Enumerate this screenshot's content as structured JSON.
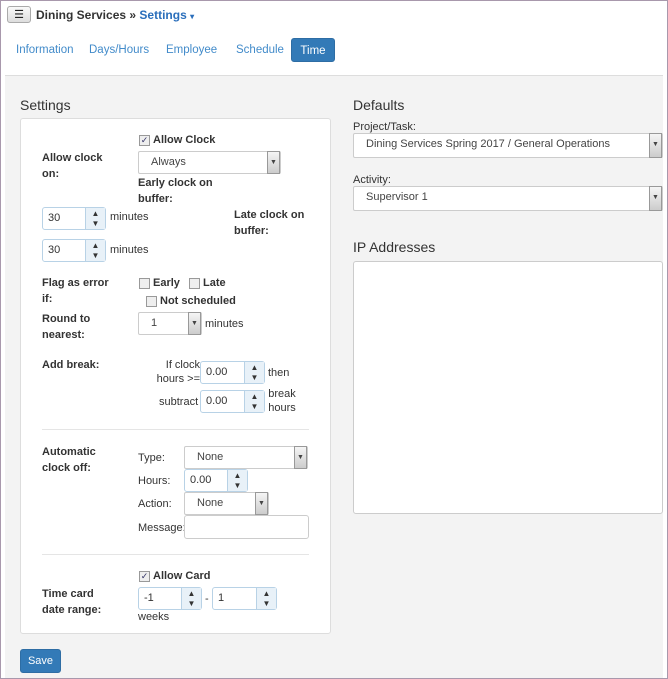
{
  "header": {
    "menu_icon": "hamburger-icon",
    "org": "Dining Services",
    "separator": "»",
    "page": "Settings",
    "caret": "▾"
  },
  "tabs": [
    {
      "label": "Information"
    },
    {
      "label": "Days/Hours"
    },
    {
      "label": "Employee"
    },
    {
      "label": "Schedule"
    },
    {
      "label": "Time",
      "active": true
    }
  ],
  "settings": {
    "title": "Settings",
    "allow_clock_label": "Allow Clock",
    "allow_clock_checked": true,
    "allow_clock_on_label": "Allow clock on:",
    "allow_clock_on_value": "Always",
    "early_label": "Early clock on buffer:",
    "early_value": "30",
    "minutes": "minutes",
    "late_label": "Late clock on buffer:",
    "late_value": "30",
    "flag_label": "Flag as error if:",
    "flag_early": "Early",
    "flag_late": "Late",
    "flag_not_scheduled": "Not scheduled",
    "round_label": "Round to nearest:",
    "round_value": "1",
    "add_break_label": "Add break:",
    "if_clock_hours": "If clock hours >=",
    "break_hours_value": "0.00",
    "then": "then",
    "subtract": "subtract",
    "subtract_value": "0.00",
    "break_hours": "break hours",
    "auto_label": "Automatic clock off:",
    "type_label": "Type:",
    "type_value": "None",
    "hours_label": "Hours:",
    "hours_value": "0.00",
    "action_label": "Action:",
    "action_value": "None",
    "message_label": "Message:",
    "message_value": "",
    "allow_card_label": "Allow Card",
    "allow_card_checked": true,
    "range_label": "Time card date range:",
    "range_from": "-1",
    "range_dash": "-",
    "range_to": "1",
    "weeks": "weeks",
    "save": "Save"
  },
  "defaults": {
    "title": "Defaults",
    "project_label": "Project/Task:",
    "project_value": "Dining Services Spring 2017 / General Operations",
    "activity_label": "Activity:",
    "activity_value": "Supervisor 1"
  },
  "ip": {
    "title": "IP Addresses",
    "value": ""
  },
  "colors": {
    "accent": "#337ab7",
    "link": "#428bca"
  }
}
